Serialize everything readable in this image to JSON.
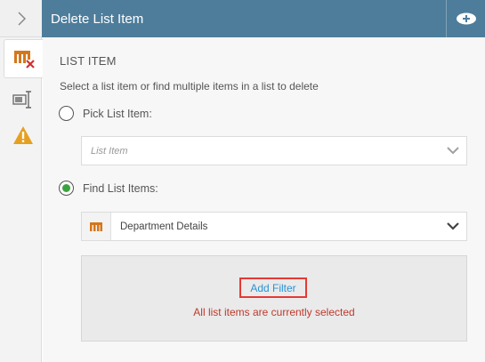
{
  "header": {
    "title": "Delete List Item"
  },
  "section": {
    "title": "LIST ITEM",
    "description": "Select a list item or find multiple items in a list to delete"
  },
  "options": {
    "pick_label": "Pick List Item:",
    "pick_placeholder": "List Item",
    "find_label": "Find List Items:",
    "find_value": "Department Details",
    "selected": "find"
  },
  "filter": {
    "add_label": "Add Filter",
    "status": "All list items are currently selected"
  },
  "colors": {
    "header": "#4e7d9b",
    "accent_green": "#3aa33f",
    "warning": "#e6a020",
    "list_icon": "#d4771c",
    "link": "#2a93d5",
    "error_text": "#c0392b",
    "highlight": "#e53935"
  },
  "icons": {
    "expand": "chevron-right-icon",
    "add": "plus-circle-icon",
    "tab_delete": "list-delete-icon",
    "tab_input": "text-input-icon",
    "tab_warning": "warning-icon",
    "dropdown": "chevron-down-icon",
    "list": "list-icon"
  }
}
